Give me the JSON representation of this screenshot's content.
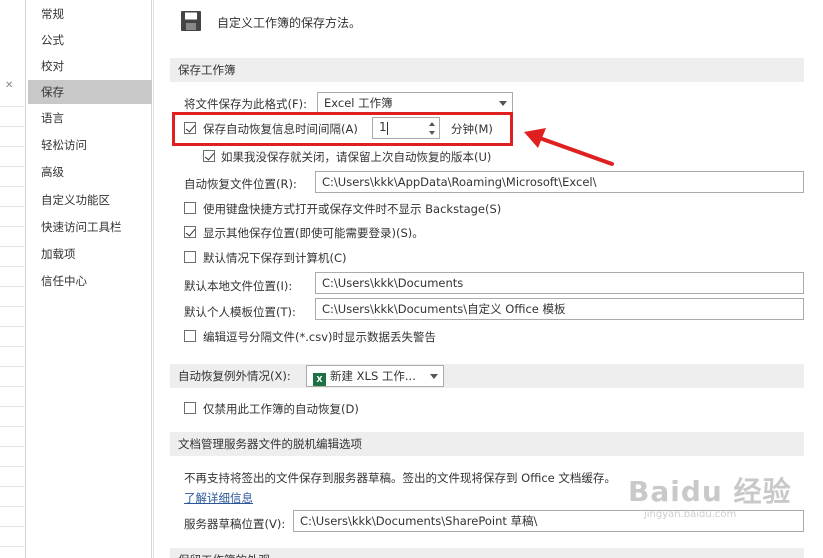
{
  "sidebar": {
    "items": [
      {
        "label": "常规"
      },
      {
        "label": "公式"
      },
      {
        "label": "校对"
      },
      {
        "label": "保存"
      },
      {
        "label": "语言"
      },
      {
        "label": "轻松访问"
      },
      {
        "label": "高级"
      },
      {
        "label": "自定义功能区"
      },
      {
        "label": "快速访问工具栏"
      },
      {
        "label": "加载项"
      },
      {
        "label": "信任中心"
      }
    ],
    "active": "保存"
  },
  "header": {
    "title": "自定义工作簿的保存方法。",
    "icon": "save-disk-icon"
  },
  "save_workbooks": {
    "section_title": "保存工作簿",
    "format_label": "将文件保存为此格式(F):",
    "format_value": "Excel 工作簿",
    "autorecover_label": "保存自动恢复信息时间间隔(A)",
    "autorecover_checked": true,
    "autorecover_minutes": "1",
    "minutes_label": "分钟(M)",
    "keep_last_label": "如果我没保存就关闭，请保留上次自动恢复的版本(U)",
    "keep_last_checked": true,
    "autorecover_location_label": "自动恢复文件位置(R):",
    "autorecover_location_value": "C:\\Users\\kkk\\AppData\\Roaming\\Microsoft\\Excel\\",
    "backstage_label": "使用键盘快捷方式打开或保存文件时不显示 Backstage(S)",
    "backstage_checked": false,
    "show_other_label": "显示其他保存位置(即使可能需要登录)(S)。",
    "show_other_checked": true,
    "save_computer_label": "默认情况下保存到计算机(C)",
    "save_computer_checked": false,
    "local_location_label": "默认本地文件位置(I):",
    "local_location_value": "C:\\Users\\kkk\\Documents",
    "template_location_label": "默认个人模板位置(T):",
    "template_location_value": "C:\\Users\\kkk\\Documents\\自定义 Office 模板",
    "csv_warning_label": "编辑逗号分隔文件(*.csv)时显示数据丢失警告",
    "csv_warning_checked": false
  },
  "autorecover_exceptions": {
    "label": "自动恢复例外情况(X):",
    "value": "新建 XLS 工作...",
    "disable_label": "仅禁用此工作簿的自动恢复(D)",
    "disable_checked": false
  },
  "offline_editing": {
    "section_title": "文档管理服务器文件的脱机编辑选项",
    "description": "不再支持将签出的文件保存到服务器草稿。签出的文件现将保存到 Office 文档缓存。",
    "link": "了解详细信息",
    "drafts_label": "服务器草稿位置(V):",
    "drafts_value": "C:\\Users\\kkk\\Documents\\SharePoint 草稿\\"
  },
  "bottom_section_title": "保留工作簿的外观",
  "watermark": {
    "brand": "Baidu 经验",
    "url": "jingyan.baidu.com"
  },
  "colors": {
    "highlight": "#e02020",
    "active_nav": "#c8c8c8",
    "section_bg": "#eeeeee",
    "link": "#2b579a"
  }
}
